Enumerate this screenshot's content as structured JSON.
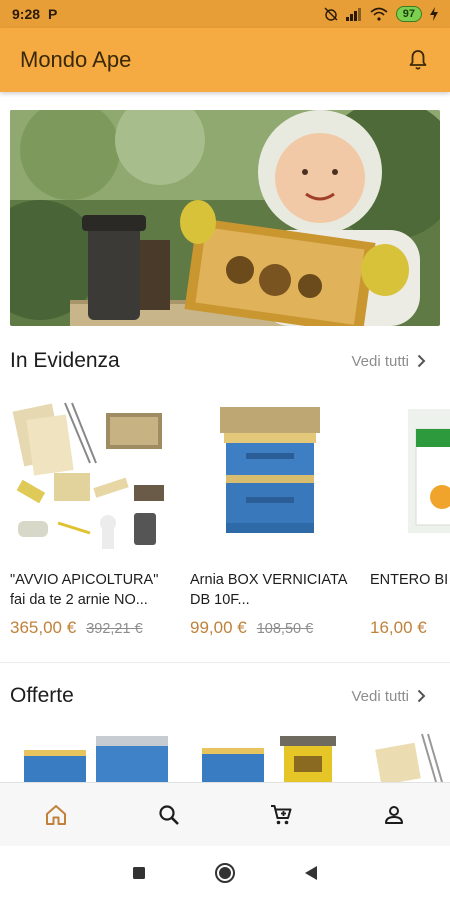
{
  "status_bar": {
    "time": "9:28",
    "carrier": "P",
    "battery": "97"
  },
  "app_bar": {
    "title": "Mondo Ape"
  },
  "sections": {
    "featured": {
      "title": "In Evidenza",
      "see_all": "Vedi tutti",
      "products": [
        {
          "name": "\"AVVIO APICOLTURA\" fai da te 2 arnie NO...",
          "price": "365,00 €",
          "old_price": "392,21 €"
        },
        {
          "name": "Arnia BOX VERNICIATA DB 10F...",
          "price": "99,00 €",
          "old_price": "108,50 €"
        },
        {
          "name": "ENTERO BI - POLVERE",
          "price": "16,00 €",
          "old_price": ""
        }
      ]
    },
    "offers": {
      "title": "Offerte",
      "see_all": "Vedi tutti"
    }
  },
  "colors": {
    "accent": "#f6ab42",
    "status_bar": "#e89e36",
    "price": "#c0823a",
    "nav_active": "#c0823a"
  },
  "bottom_nav": [
    "home-icon",
    "search-icon",
    "cart-icon",
    "account-icon"
  ]
}
